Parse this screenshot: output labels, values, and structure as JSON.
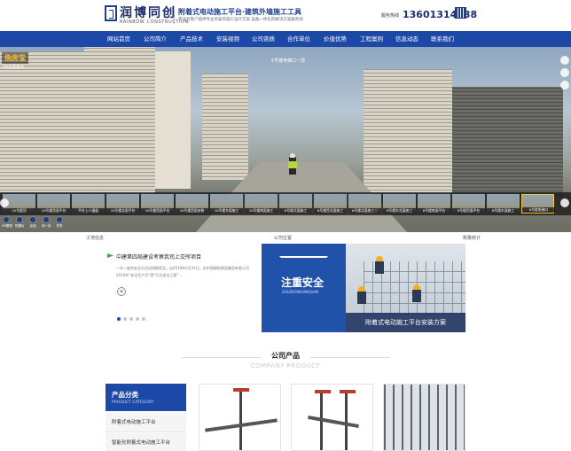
{
  "header": {
    "logo_text": "润博同创",
    "logo_en": "RAINBOW CONSTRUCTION",
    "slogan": "附着式电动施工平台·建筑外墙施工工具",
    "slogan_sub": "专注为客户提供专业的安装施工设计方案 设备一体化的解决方案服务商",
    "hotline_label": "服务热线",
    "hotline": "13601314238"
  },
  "nav": {
    "items": [
      "网站首页",
      "公司简介",
      "产品技术",
      "安装视频",
      "公司资质",
      "合作单位",
      "价值优势",
      "工程案例",
      "信息动态",
      "联系我们"
    ]
  },
  "hero": {
    "brand": "指房宝",
    "brand_sub": "VR全景看房",
    "scene_title": "6号楼电梯口一层",
    "thumbs": [
      "10号楼顶",
      "10号楼西面平台",
      "平台上人通道",
      "10号楼北面平台",
      "10号楼西面平台",
      "10号楼西面安装",
      "10号楼东面施工",
      "10号楼南面施工",
      "6号楼北面施工",
      "6号楼西北面施工",
      "6号楼北面施工二",
      "6号楼东北面施工",
      "6号楼南面平台",
      "6号楼西面平台",
      "6号楼东面施工",
      "6号楼电梯口"
    ],
    "tools": [
      "VR眼镜",
      "陀螺仪",
      "足迹",
      "说一说",
      "导览"
    ]
  },
  "tabs": {
    "left": "工地信息",
    "middle": "公司位置",
    "right": "数量统计"
  },
  "news": {
    "title": "中建第四局建设考察我司上交所项目",
    "line1": "一年一度的安全月活动如期而至。自2019年5月31日，由中国建筑建设集团有限公司",
    "line2": "2019年“安全生产月”暨“行为安全之星”...",
    "more_icon": "plus-circle-icon"
  },
  "promo": {
    "headline": "注重安全",
    "pinyin": "ZHUZHONGANQUAN",
    "caption": "附着式电动施工平台安装方案"
  },
  "products": {
    "title": "公司产品",
    "subtitle": "COMPANY PRODUCT",
    "category_title": "产品分类",
    "category_sub": "PRODUCT CATEGORY",
    "categories": [
      "附着式电动施工平台",
      "智能化附着式电动施工平台"
    ]
  },
  "colors": {
    "brand_blue": "#1c49a7",
    "promo_blue": "#1f52a8",
    "accent_green": "#46a34a"
  }
}
